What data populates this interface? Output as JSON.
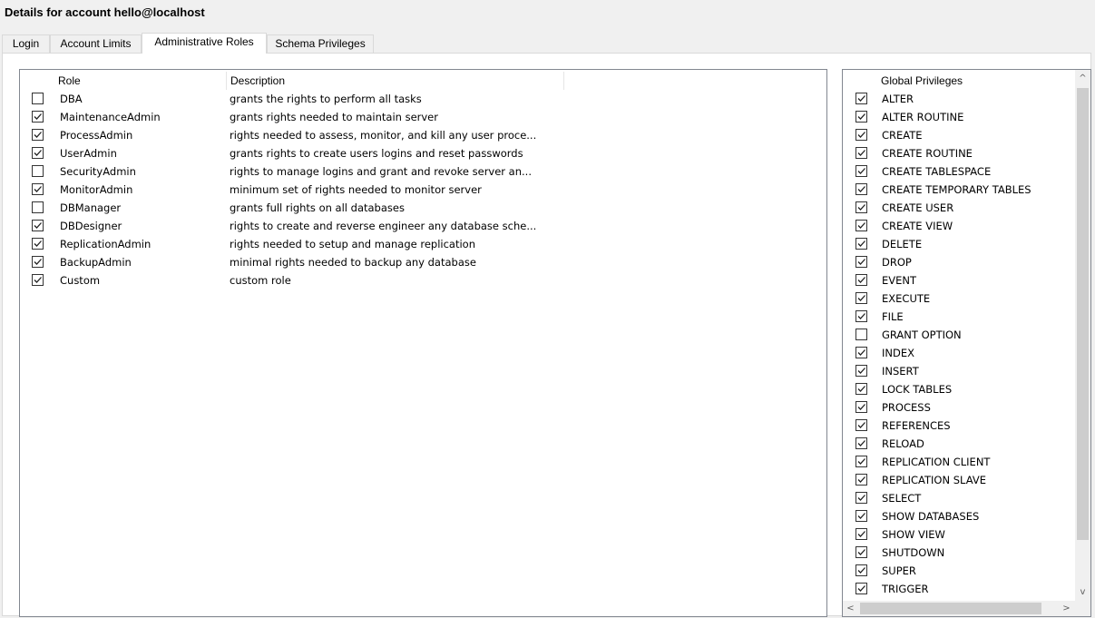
{
  "window": {
    "title": "Details for account hello@localhost"
  },
  "tabs": [
    {
      "label": "Login"
    },
    {
      "label": "Account Limits"
    },
    {
      "label": "Administrative Roles"
    },
    {
      "label": "Schema Privileges"
    }
  ],
  "roles": {
    "headers": {
      "role": "Role",
      "description": "Description"
    },
    "rows": [
      {
        "role": "DBA",
        "description": "grants the rights to perform all tasks",
        "checked": false
      },
      {
        "role": "MaintenanceAdmin",
        "description": "grants rights needed to maintain server",
        "checked": true
      },
      {
        "role": "ProcessAdmin",
        "description": "rights needed to assess, monitor, and kill any user proce...",
        "checked": true
      },
      {
        "role": "UserAdmin",
        "description": "grants rights to create users logins and reset passwords",
        "checked": true
      },
      {
        "role": "SecurityAdmin",
        "description": "rights to manage logins and grant and revoke server an...",
        "checked": false
      },
      {
        "role": "MonitorAdmin",
        "description": "minimum set of rights needed to monitor server",
        "checked": true
      },
      {
        "role": "DBManager",
        "description": "grants full rights on all databases",
        "checked": false
      },
      {
        "role": "DBDesigner",
        "description": "rights to create and reverse engineer any database sche...",
        "checked": true
      },
      {
        "role": "ReplicationAdmin",
        "description": "rights needed to setup and manage replication",
        "checked": true
      },
      {
        "role": "BackupAdmin",
        "description": "minimal rights needed to backup any database",
        "checked": true
      },
      {
        "role": "Custom",
        "description": "custom role",
        "checked": true
      }
    ]
  },
  "privileges": {
    "header": "Global Privileges",
    "rows": [
      {
        "name": "ALTER",
        "checked": true
      },
      {
        "name": "ALTER ROUTINE",
        "checked": true
      },
      {
        "name": "CREATE",
        "checked": true
      },
      {
        "name": "CREATE ROUTINE",
        "checked": true
      },
      {
        "name": "CREATE TABLESPACE",
        "checked": true
      },
      {
        "name": "CREATE TEMPORARY TABLES",
        "checked": true
      },
      {
        "name": "CREATE USER",
        "checked": true
      },
      {
        "name": "CREATE VIEW",
        "checked": true
      },
      {
        "name": "DELETE",
        "checked": true
      },
      {
        "name": "DROP",
        "checked": true
      },
      {
        "name": "EVENT",
        "checked": true
      },
      {
        "name": "EXECUTE",
        "checked": true
      },
      {
        "name": "FILE",
        "checked": true
      },
      {
        "name": "GRANT OPTION",
        "checked": false
      },
      {
        "name": "INDEX",
        "checked": true
      },
      {
        "name": "INSERT",
        "checked": true
      },
      {
        "name": "LOCK TABLES",
        "checked": true
      },
      {
        "name": "PROCESS",
        "checked": true
      },
      {
        "name": "REFERENCES",
        "checked": true
      },
      {
        "name": "RELOAD",
        "checked": true
      },
      {
        "name": "REPLICATION CLIENT",
        "checked": true
      },
      {
        "name": "REPLICATION SLAVE",
        "checked": true
      },
      {
        "name": "SELECT",
        "checked": true
      },
      {
        "name": "SHOW DATABASES",
        "checked": true
      },
      {
        "name": "SHOW VIEW",
        "checked": true
      },
      {
        "name": "SHUTDOWN",
        "checked": true
      },
      {
        "name": "SUPER",
        "checked": true
      },
      {
        "name": "TRIGGER",
        "checked": true
      }
    ]
  },
  "scrollbar": {
    "up": "^",
    "down": "v",
    "left": "<",
    "right": ">"
  }
}
